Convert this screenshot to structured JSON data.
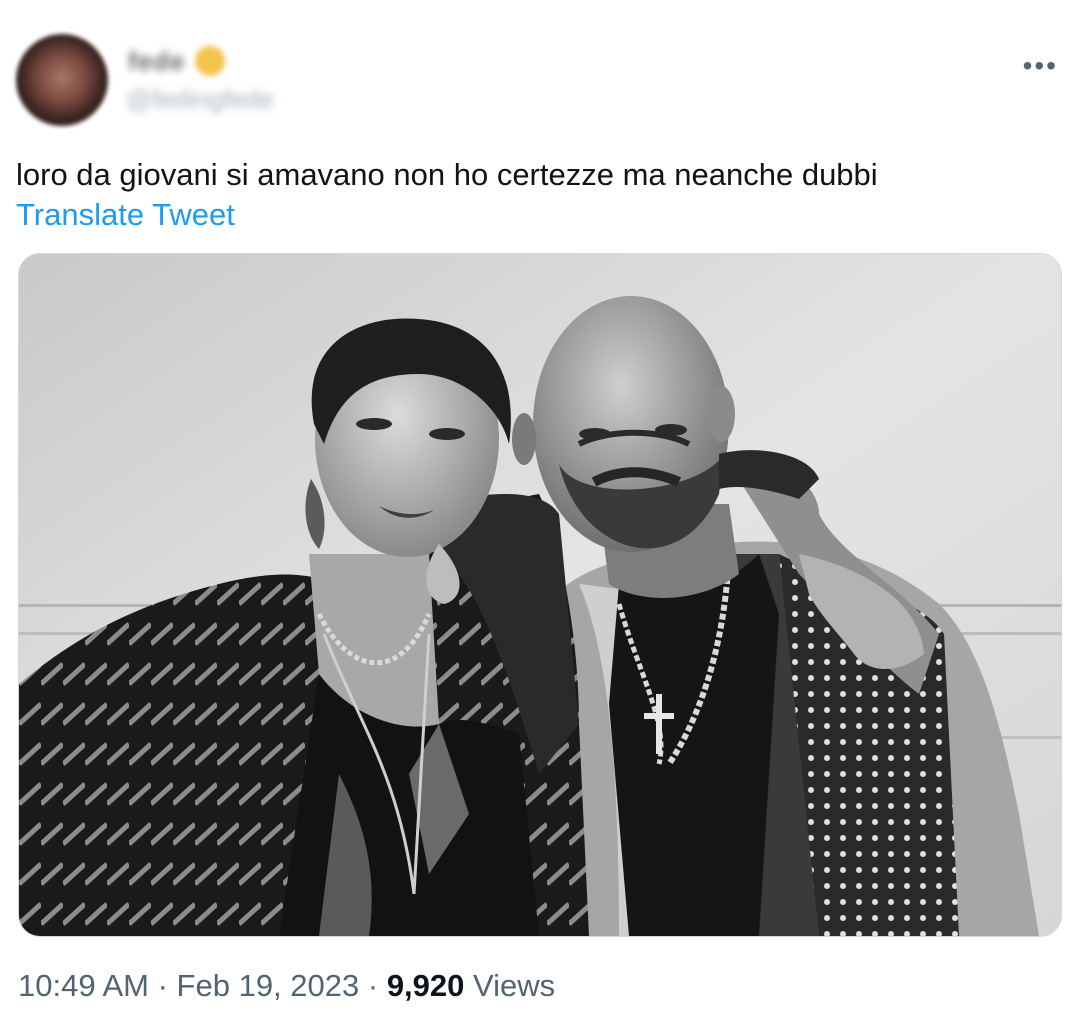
{
  "author": {
    "display_name": "fede",
    "handle": "@fedingfede",
    "verified_badge_color": "#f2c44a",
    "avatar_icon": "profile-photo"
  },
  "menu": {
    "more_label": "•••",
    "icon": "more-options-icon"
  },
  "tweet": {
    "text": "loro da giovani si amavano non ho certezze ma neanche dubbi",
    "translate_label": "Translate Tweet"
  },
  "media": {
    "kind": "photo",
    "style": "black-and-white"
  },
  "meta": {
    "time": "10:49 AM",
    "separator": " · ",
    "date": "Feb 19, 2023",
    "views_count": "9,920",
    "views_label": " Views"
  },
  "colors": {
    "link": "#1d9bf0",
    "text": "#0f1419",
    "secondary": "#536471"
  }
}
